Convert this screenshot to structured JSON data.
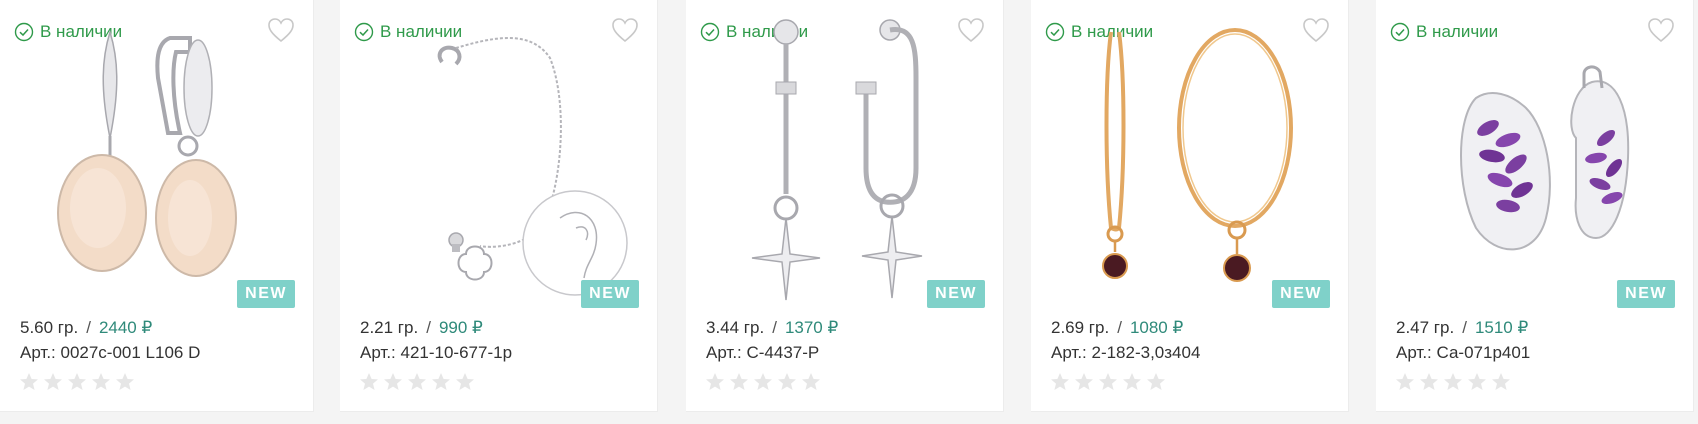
{
  "colors": {
    "stock_green": "#2f9a4a",
    "price_teal": "#2f8a7a",
    "new_badge": "#7fd1c9",
    "star_empty": "#e6e6e6"
  },
  "products": [
    {
      "stock": "В наличии",
      "badge": "NEW",
      "weight": "5.60 гр.",
      "sep": "/",
      "price": "2440 ₽",
      "article": "Арт.: 0027с-001 L106 D",
      "rating": 0,
      "image_icon": "drop-earrings-pink-stone-icon"
    },
    {
      "stock": "В наличии",
      "badge": "NEW",
      "weight": "2.21 гр.",
      "sep": "/",
      "price": "990 ₽",
      "article": "Арт.: 421-10-677-1р",
      "rating": 0,
      "image_icon": "chain-ear-cuff-icon"
    },
    {
      "stock": "В наличии",
      "badge": "NEW",
      "weight": "3.44 гр.",
      "sep": "/",
      "price": "1370 ₽",
      "article": "Арт.: С-4437-Р",
      "rating": 0,
      "image_icon": "star-hoop-earrings-icon"
    },
    {
      "stock": "В наличии",
      "badge": "NEW",
      "weight": "2.69 гр.",
      "sep": "/",
      "price": "1080 ₽",
      "article": "Арт.: 2-182-3,0з404",
      "rating": 0,
      "image_icon": "gold-hoop-garnet-earrings-icon"
    },
    {
      "stock": "В наличии",
      "badge": "NEW",
      "weight": "2.47 гр.",
      "sep": "/",
      "price": "1510 ₽",
      "article": "Арт.: Са-071р401",
      "rating": 0,
      "image_icon": "amethyst-cluster-earrings-icon"
    }
  ]
}
